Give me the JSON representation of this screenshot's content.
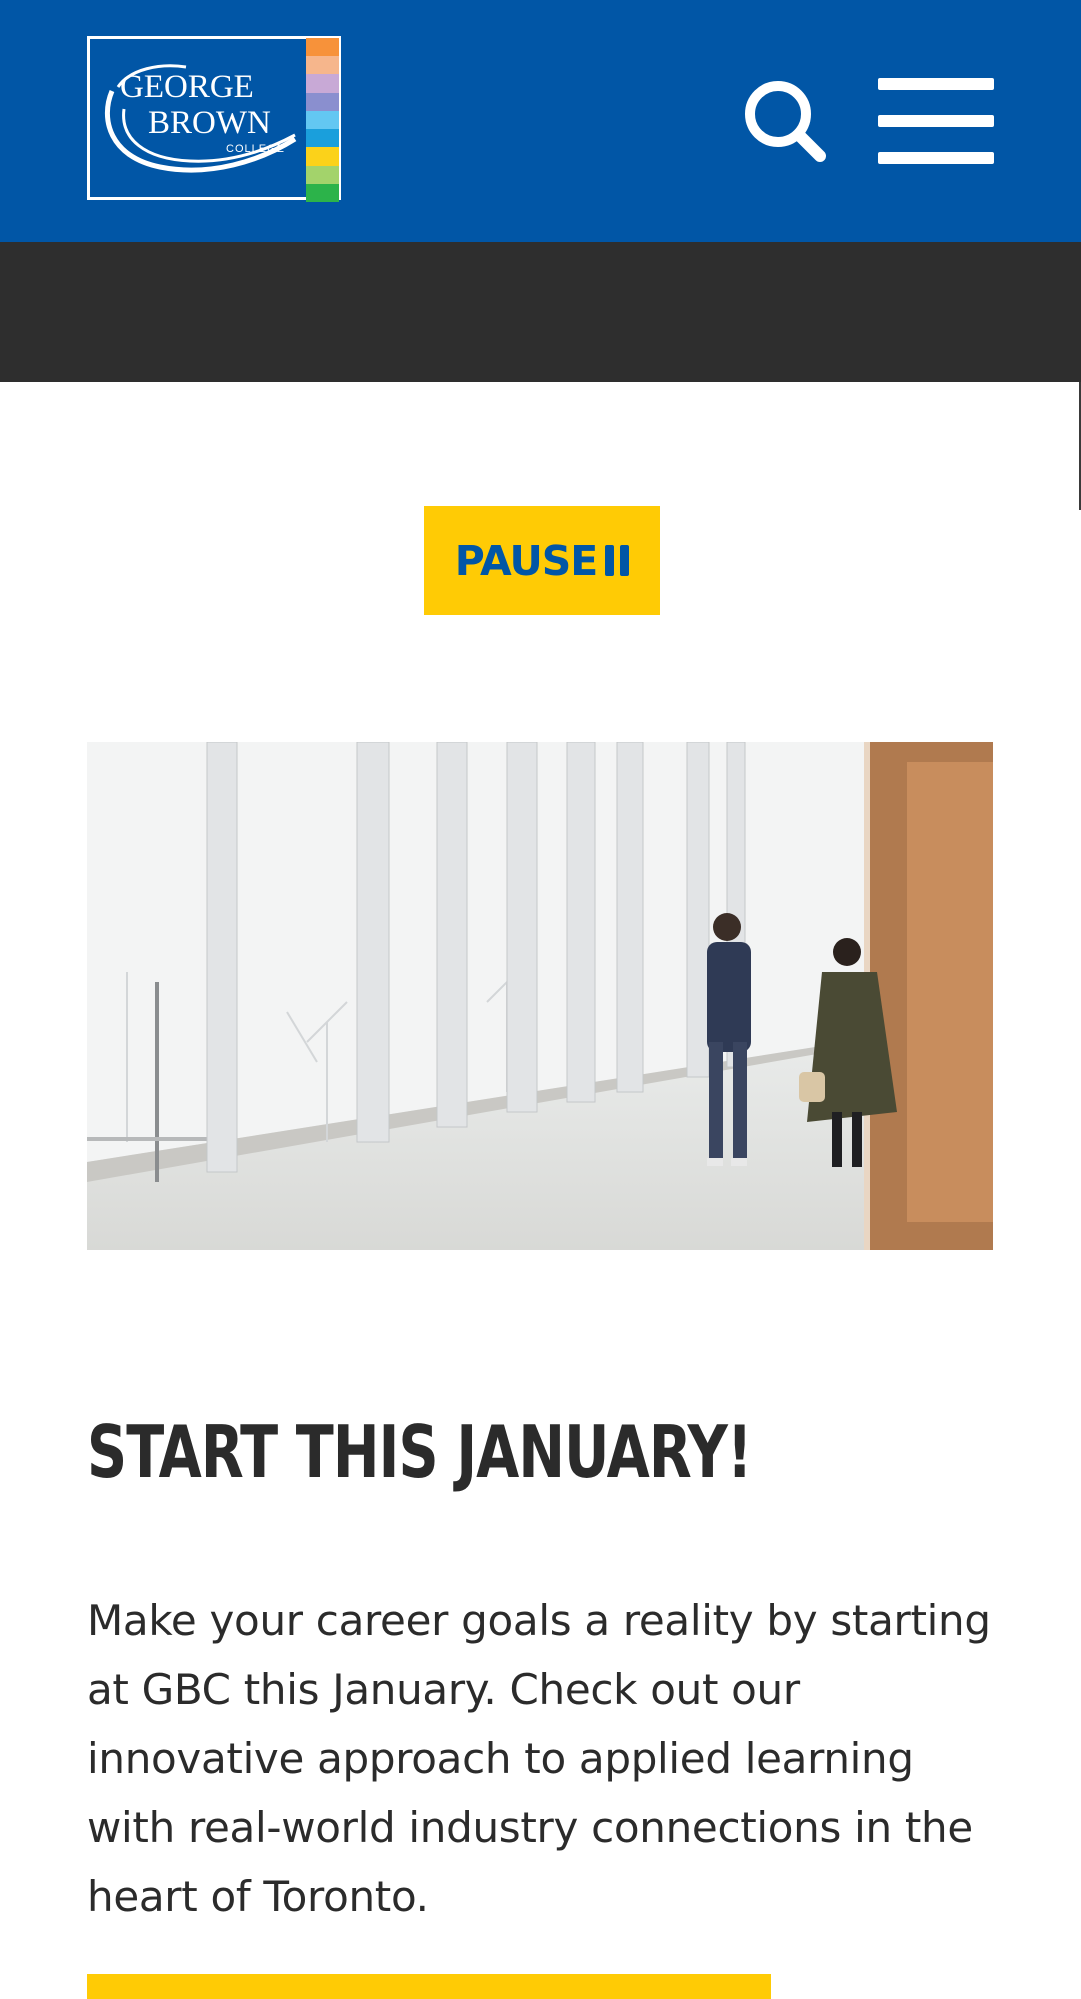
{
  "header": {
    "logo": {
      "alt": "George Brown College",
      "line1": "GEORGE",
      "line2": "BROWN",
      "line3": "COLLEGE",
      "stripe_colors": [
        "#f7923a",
        "#f6b68c",
        "#c8a9d6",
        "#8a8fcf",
        "#63c7f2",
        "#1a9fdc",
        "#fbd21a",
        "#a3d36b",
        "#2cb34a"
      ]
    },
    "search_icon": "search-icon",
    "menu_icon": "hamburger-menu-icon",
    "background": "#0156a6"
  },
  "carousel": {
    "pause_label": "PAUSE",
    "pause_icon": "pause-icon",
    "accent": "#ffcb05"
  },
  "hero_image": {
    "alt": "Two students walking along a glass corridor"
  },
  "content": {
    "heading": "START THIS JANUARY!",
    "body": "Make your career goals a reality by starting at GBC this January. Check out our innovative approach to applied learning with real-world industry connections in the heart of Toronto."
  }
}
